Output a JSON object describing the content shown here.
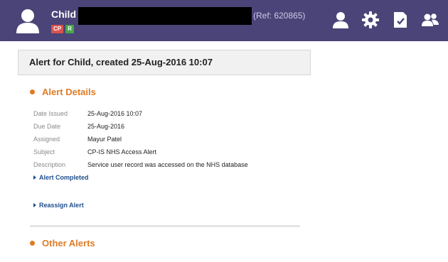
{
  "header": {
    "name": "Child",
    "badges": {
      "cp": "CP",
      "r": "R"
    },
    "ref": "(Ref: 620865)",
    "colors": {
      "bar": "#4a4478",
      "cp": "#d9534f",
      "r": "#48a548"
    },
    "icons": [
      "person-icon",
      "gear-icon",
      "document-icon",
      "group-icon"
    ]
  },
  "alert": {
    "title": "Alert for Child, created 25-Aug-2016 10:07"
  },
  "details": {
    "heading": "Alert Details",
    "rows": [
      {
        "label": "Date Issued",
        "value": "25-Aug-2016 10:07"
      },
      {
        "label": "Due Date",
        "value": "25-Aug-2016"
      },
      {
        "label": "Assigned",
        "value": "Mayur Patel"
      },
      {
        "label": "Subject",
        "value": "CP-IS NHS Access Alert"
      },
      {
        "label": "Description",
        "value": "Service user record was accessed on the NHS database"
      }
    ]
  },
  "actions": {
    "completed": "Alert Completed",
    "reassign": "Reassign Alert"
  },
  "other": {
    "heading": "Other Alerts"
  },
  "accent": "#e07b25"
}
